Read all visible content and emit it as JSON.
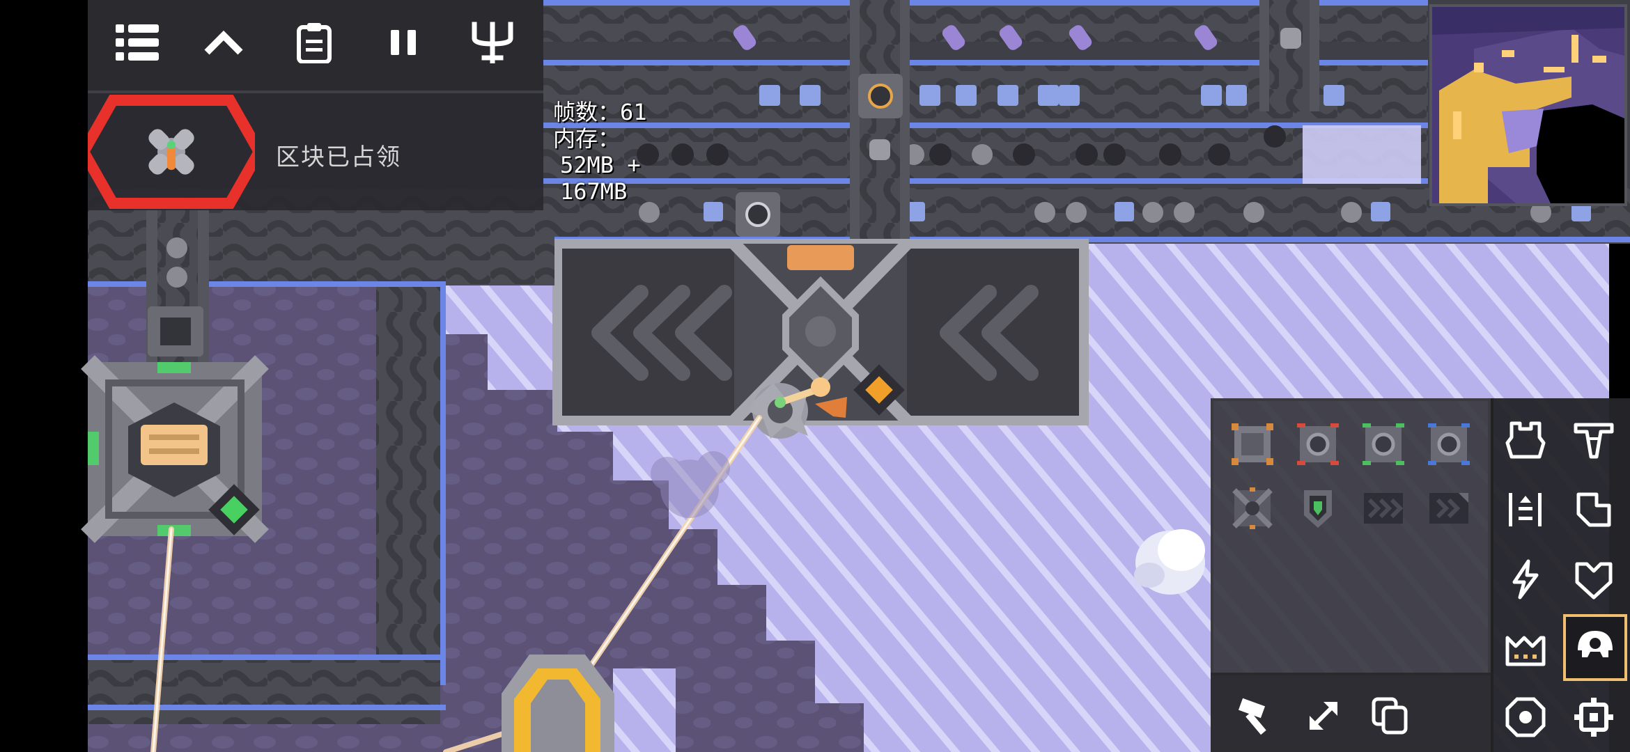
{
  "hud": {
    "top_buttons": [
      {
        "name": "menu-button",
        "icon": "list-icon"
      },
      {
        "name": "collapse-button",
        "icon": "chevron-up-icon"
      },
      {
        "name": "database-button",
        "icon": "clipboard-icon"
      },
      {
        "name": "pause-button",
        "icon": "pause-icon"
      },
      {
        "name": "tech-tree-button",
        "icon": "trident-icon"
      }
    ],
    "core_status": "区块已占领"
  },
  "stats": {
    "fps_label": "帧数：61",
    "memory_label": "内存：",
    "memory_heap": "52MB +",
    "memory_native": "167MB"
  },
  "build_menu": {
    "blocks": [
      {
        "name": "block-container",
        "icon": "container-icon"
      },
      {
        "name": "block-unloader-red",
        "icon": "unloader-icon"
      },
      {
        "name": "block-unloader-green",
        "icon": "unloader-icon"
      },
      {
        "name": "block-unloader-blue",
        "icon": "unloader-icon"
      },
      {
        "name": "block-mass-driver",
        "icon": "mass-driver-icon"
      },
      {
        "name": "block-shield",
        "icon": "shield-block-icon"
      },
      {
        "name": "block-duct",
        "icon": "duct-icon"
      },
      {
        "name": "block-duct-bridge",
        "icon": "duct-bridge-icon"
      }
    ],
    "tools": [
      {
        "name": "hammer-tool-button",
        "icon": "hammer-icon"
      },
      {
        "name": "expand-tool-button",
        "icon": "expand-icon"
      },
      {
        "name": "copy-tool-button",
        "icon": "copy-icon"
      }
    ],
    "categories": [
      {
        "name": "category-turret",
        "icon": "turret-icon",
        "selected": false
      },
      {
        "name": "category-production",
        "icon": "drill-icon",
        "selected": false
      },
      {
        "name": "category-distribution",
        "icon": "distribution-icon",
        "selected": false
      },
      {
        "name": "category-liquid",
        "icon": "liquid-icon",
        "selected": false
      },
      {
        "name": "category-power",
        "icon": "lightning-icon",
        "selected": false
      },
      {
        "name": "category-defense",
        "icon": "shield-icon",
        "selected": false
      },
      {
        "name": "category-crafting",
        "icon": "factory-icon",
        "selected": false
      },
      {
        "name": "category-units",
        "icon": "unit-icon",
        "selected": true
      },
      {
        "name": "category-effect",
        "icon": "effect-icon",
        "selected": false
      },
      {
        "name": "category-logic",
        "icon": "logic-gear-icon",
        "selected": false
      }
    ]
  },
  "colors": {
    "floor_purple": "#5e5478",
    "ice": "#b9b4ee",
    "conveyor": "#4a4a52",
    "conveyor_edge": "#6b86e6",
    "core_accent": "#f2c48a",
    "hazard_red": "#e8312a",
    "selected_border": "#f0c070",
    "node_gold": "#f2b830"
  }
}
